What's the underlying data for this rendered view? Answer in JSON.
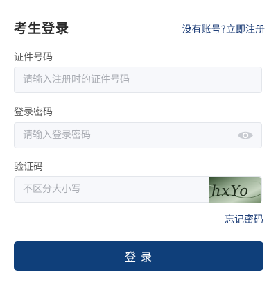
{
  "header": {
    "title": "考生登录",
    "register_link": "没有账号?立即注册"
  },
  "form": {
    "id_number": {
      "label": "证件号码",
      "placeholder": "请输入注册时的证件号码",
      "value": ""
    },
    "password": {
      "label": "登录密码",
      "placeholder": "请输入登录密码",
      "value": "",
      "toggle_icon": "eye-icon"
    },
    "captcha": {
      "label": "验证码",
      "placeholder": "不区分大小写",
      "value": "",
      "image_text": "hxYo"
    },
    "forgot_link": "忘记密码",
    "submit_label": "登 录"
  },
  "colors": {
    "primary": "#0f3f7a",
    "link": "#1f3f78",
    "input_bg": "#f7f8fb",
    "input_border": "#e3e6eb"
  }
}
